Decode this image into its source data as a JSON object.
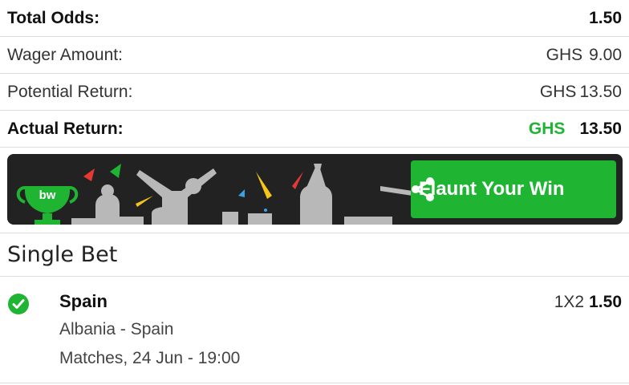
{
  "summary": {
    "total_odds_label": "Total Odds:",
    "total_odds_value": "1.50",
    "wager_label": "Wager Amount:",
    "wager_currency": "GHS",
    "wager_value": "9.00",
    "potential_label": "Potential Return:",
    "potential_currency": "GHS",
    "potential_value": "13.50",
    "actual_label": "Actual Return:",
    "actual_currency": "GHS",
    "actual_value": "13.50"
  },
  "banner": {
    "logo_text": "bw",
    "button_label": "Flaunt Your Win",
    "icons": [
      "trophy-icon",
      "share-icon"
    ]
  },
  "bets": {
    "section_title": "Single Bet",
    "items": [
      {
        "selection": "Spain",
        "market": "1X2",
        "odds": "1.50",
        "match": "Albania - Spain",
        "when": "Matches, 24 Jun - 19:00",
        "status_icon": "check-circle-icon"
      }
    ]
  },
  "colors": {
    "accent_green": "#1fb533",
    "banner_bg": "#222222"
  }
}
